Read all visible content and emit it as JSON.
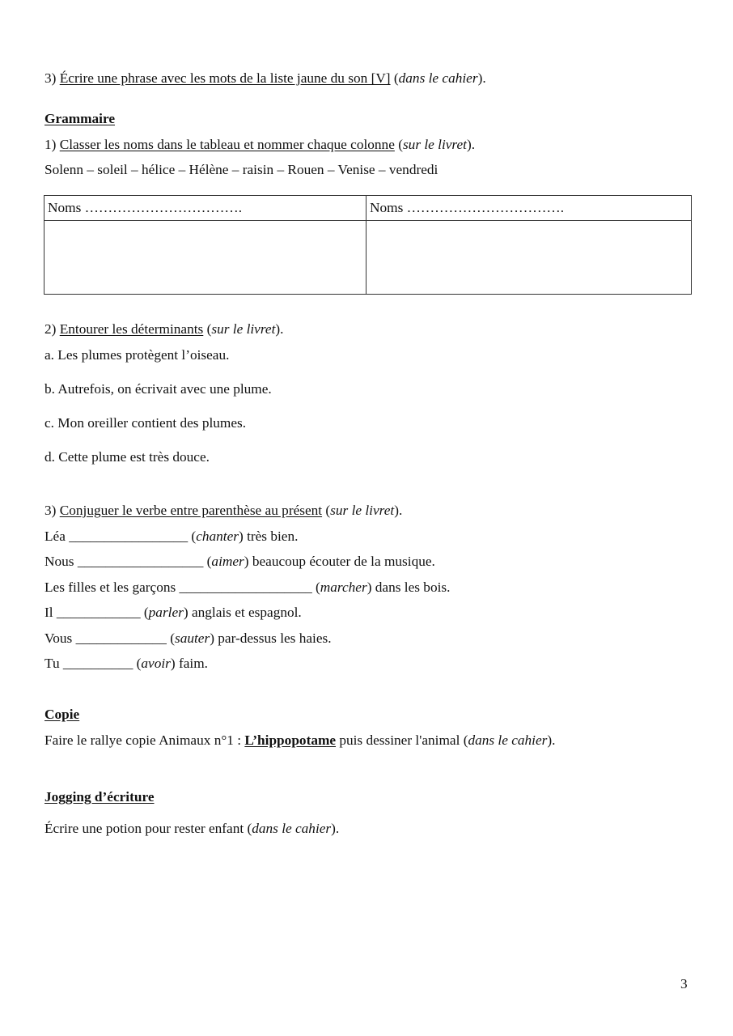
{
  "section_vocab": {
    "item3": {
      "num": "3) ",
      "instruction": "Écrire une phrase avec les mots de la liste jaune du son [V]",
      "open": " (",
      "where": "dans le cahier",
      "close": ")."
    }
  },
  "grammaire": {
    "heading": "Grammaire",
    "ex1": {
      "num": "1) ",
      "instruction": "Classer les noms dans le tableau et nommer chaque colonne",
      "open": " (",
      "where": "sur le livret",
      "close": ").",
      "word_list": "Solenn – soleil – hélice – Hélène – raisin – Rouen – Venise – vendredi",
      "table": {
        "columns": [
          "Noms …………………………….",
          "Noms ……………………………."
        ]
      }
    },
    "ex2": {
      "num": "2) ",
      "instruction": "Entourer les déterminants",
      "open": " (",
      "where": "sur le livret",
      "close": ").",
      "sentences": [
        "a. Les plumes protègent l’oiseau.",
        "b. Autrefois, on écrivait avec une plume.",
        "c. Mon oreiller contient des plumes.",
        "d. Cette plume est très douce."
      ]
    },
    "ex3": {
      "num": "3) ",
      "instruction": "Conjuguer le verbe entre parenthèse au présent",
      "open": " (",
      "where": "sur le livret",
      "close": ").",
      "lines": [
        {
          "subject": "Léa ",
          "blank": "_________________",
          "verb": "chanter",
          "rest": " très bien."
        },
        {
          "subject": "Nous ",
          "blank": "__________________",
          "verb": "aimer",
          "rest": " beaucoup écouter de la musique."
        },
        {
          "subject": "Les filles et les garçons ",
          "blank": "___________________",
          "verb": "marcher",
          "rest": " dans les bois."
        },
        {
          "subject": "Il ",
          "blank": "____________",
          "verb": "parler",
          "rest": " anglais et espagnol."
        },
        {
          "subject": "Vous ",
          "blank": "_____________",
          "verb": "sauter",
          "rest": " par-dessus les haies."
        },
        {
          "subject": "Tu ",
          "blank": "__________",
          "verb": "avoir",
          "rest": " faim."
        }
      ]
    }
  },
  "copie": {
    "heading": "Copie",
    "pre": "Faire le rallye copie Animaux n°1 : ",
    "title": "L’hippopotame",
    "post": " puis dessiner l'animal (",
    "where": "dans le cahier",
    "close": ")."
  },
  "jogging": {
    "heading": "Jogging d’écriture",
    "text": "Écrire une potion pour rester enfant (",
    "where": "dans le cahier",
    "close": ")."
  },
  "page_number": "3"
}
